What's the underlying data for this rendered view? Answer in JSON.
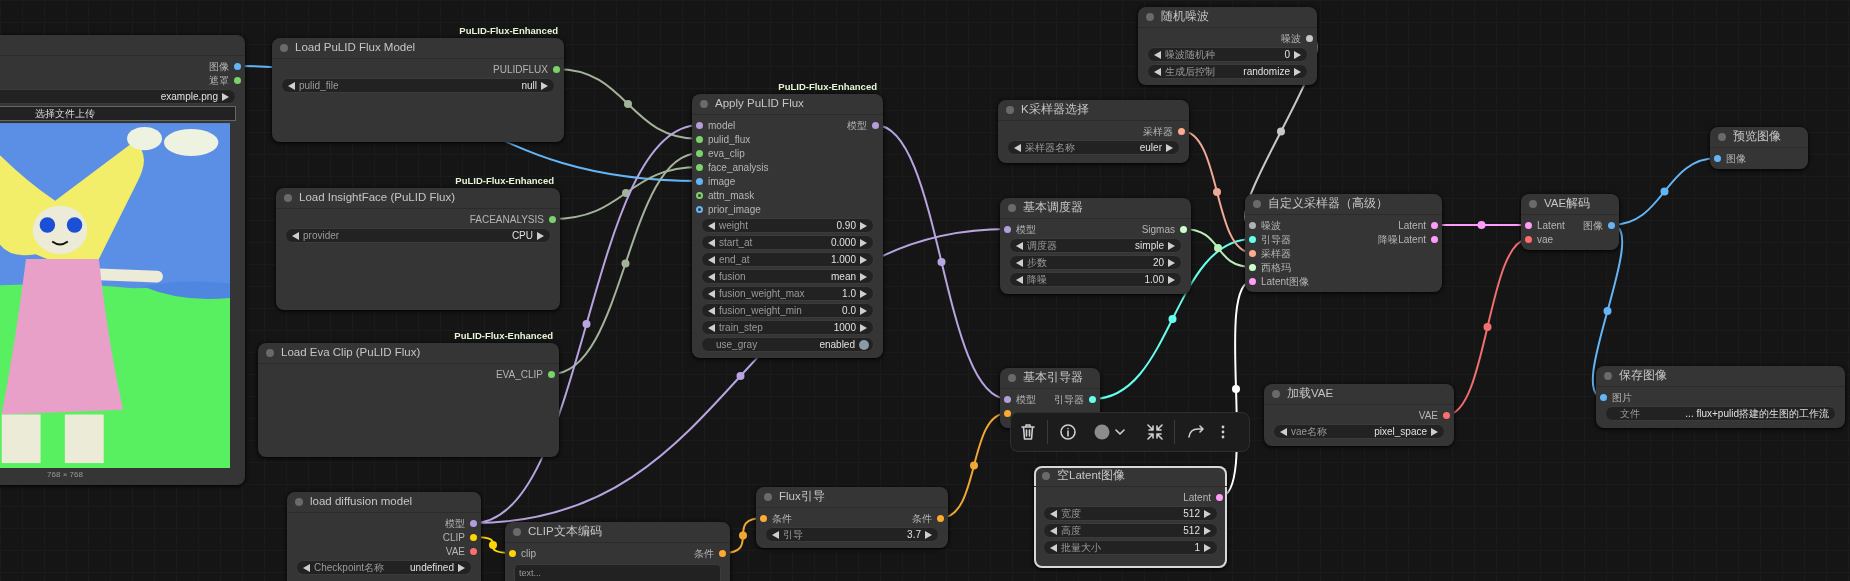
{
  "nodes": [
    {
      "selected": false,
      "outputs": [
        {
          "label": "图像",
          "color": "#64b5f6"
        },
        {
          "label": "遮罩",
          "color": "#7bd36b"
        }
      ],
      "widgets": [
        {
          "kind": "combo",
          "value": "example.png"
        },
        {
          "kind": "button",
          "label": "选择文件上传"
        }
      ],
      "image_preview": {
        "caption": "768 × 768"
      }
    },
    {
      "title": "Load PuLID Flux Model",
      "tag": "PuLID-Flux-Enhanced",
      "selected": false,
      "outputs": [
        {
          "label": "PULIDFLUX",
          "color": "#7bd36b"
        }
      ],
      "widgets": [
        {
          "kind": "combo",
          "label": "pulid_file",
          "value": "null"
        }
      ]
    },
    {
      "title": "Load InsightFace (PuLID Flux)",
      "tag": "PuLID-Flux-Enhanced",
      "selected": false,
      "outputs": [
        {
          "label": "FACEANALYSIS",
          "color": "#7bd36b"
        }
      ],
      "widgets": [
        {
          "kind": "combo",
          "label": "provider",
          "value": "CPU"
        }
      ]
    },
    {
      "title": "Load Eva Clip (PuLID Flux)",
      "tag": "PuLID-Flux-Enhanced",
      "selected": false,
      "outputs": [
        {
          "label": "EVA_CLIP",
          "color": "#7bd36b"
        }
      ]
    },
    {
      "title": "load diffusion model",
      "selected": false,
      "outputs": [
        {
          "label": "模型",
          "color": "#b39ddb"
        },
        {
          "label": "CLIP",
          "color": "#ffd500"
        },
        {
          "label": "VAE",
          "color": "#ff6e6e"
        }
      ],
      "widgets": [
        {
          "kind": "combo",
          "label": "Checkpoint名称",
          "value": "undefined"
        }
      ]
    },
    {
      "title": "CLIP文本编码",
      "selected": false,
      "inputs": [
        {
          "label": "clip",
          "color": "#ffd500",
          "optional": false
        }
      ],
      "outputs": [
        {
          "label": "条件",
          "color": "#ffa931"
        }
      ],
      "widgets": [
        {
          "kind": "text",
          "placeholder": "text..."
        }
      ]
    },
    {
      "title": "Apply PuLID Flux",
      "tag": "PuLID-Flux-Enhanced",
      "selected": false,
      "inputs": [
        {
          "label": "model",
          "color": "#b39ddb",
          "optional": false
        },
        {
          "label": "pulid_flux",
          "color": "#7bd36b",
          "optional": false
        },
        {
          "label": "eva_clip",
          "color": "#7bd36b",
          "optional": false
        },
        {
          "label": "face_analysis",
          "color": "#7bd36b",
          "optional": false
        },
        {
          "label": "image",
          "color": "#64b5f6",
          "optional": false
        },
        {
          "label": "attn_mask",
          "color": "#7bd36b",
          "optional": true
        },
        {
          "label": "prior_image",
          "color": "#64b5f6",
          "optional": true
        }
      ],
      "outputs": [
        {
          "label": "模型",
          "color": "#b39ddb"
        }
      ],
      "widgets": [
        {
          "kind": "number",
          "label": "weight",
          "value": "0.90"
        },
        {
          "kind": "number",
          "label": "start_at",
          "value": "0.000"
        },
        {
          "kind": "number",
          "label": "end_at",
          "value": "1.000"
        },
        {
          "kind": "combo",
          "label": "fusion",
          "value": "mean"
        },
        {
          "kind": "number",
          "label": "fusion_weight_max",
          "value": "1.0"
        },
        {
          "kind": "number",
          "label": "fusion_weight_min",
          "value": "0.0"
        },
        {
          "kind": "number",
          "label": "train_step",
          "value": "1000"
        },
        {
          "kind": "toggle",
          "label": "use_gray",
          "value": "enabled",
          "on": true
        }
      ]
    },
    {
      "title": "随机噪波",
      "selected": false,
      "outputs": [
        {
          "label": "噪波",
          "color": "#c8c8c8"
        }
      ],
      "widgets": [
        {
          "kind": "number",
          "label": "噪波随机种",
          "value": "0"
        },
        {
          "kind": "combo",
          "label": "生成后控制",
          "value": "randomize"
        }
      ]
    },
    {
      "title": "K采样器选择",
      "selected": false,
      "outputs": [
        {
          "label": "采样器",
          "color": "#ffab91"
        }
      ],
      "widgets": [
        {
          "kind": "combo",
          "label": "采样器名称",
          "value": "euler"
        }
      ]
    },
    {
      "title": "基本调度器",
      "selected": false,
      "inputs": [
        {
          "label": "模型",
          "color": "#b39ddb",
          "optional": false
        }
      ],
      "outputs": [
        {
          "label": "Sigmas",
          "color": "#cdffcd"
        }
      ],
      "widgets": [
        {
          "kind": "combo",
          "label": "调度器",
          "value": "simple"
        },
        {
          "kind": "number",
          "label": "步数",
          "value": "20"
        },
        {
          "kind": "number",
          "label": "降噪",
          "value": "1.00"
        }
      ]
    },
    {
      "title": "自定义采样器（高级）",
      "selected": false,
      "inputs": [
        {
          "label": "噪波",
          "color": "#b0b0b0",
          "optional": false
        },
        {
          "label": "引导器",
          "color": "#66ffee",
          "optional": false
        },
        {
          "label": "采样器",
          "color": "#ffab91",
          "optional": false
        },
        {
          "label": "西格玛",
          "color": "#cdffcd",
          "optional": false
        },
        {
          "label": "Latent图像",
          "color": "#ff9cf9",
          "optional": false
        }
      ],
      "outputs": [
        {
          "label": "Latent",
          "color": "#ff9cf9"
        },
        {
          "label": "降噪Latent",
          "color": "#ff9cf9"
        }
      ]
    },
    {
      "title": "VAE解码",
      "selected": false,
      "inputs": [
        {
          "label": "Latent",
          "color": "#ff9cf9",
          "optional": false
        },
        {
          "label": "vae",
          "color": "#ff6e6e",
          "optional": false
        }
      ],
      "outputs": [
        {
          "label": "图像",
          "color": "#64b5f6"
        }
      ]
    },
    {
      "title": "预览图像",
      "selected": false,
      "inputs": [
        {
          "label": "图像",
          "color": "#64b5f6",
          "optional": false
        }
      ]
    },
    {
      "title": "保存图像",
      "selected": false,
      "inputs": [
        {
          "label": "图片",
          "color": "#64b5f6",
          "optional": false
        }
      ],
      "widgets": [
        {
          "kind": "string",
          "label": "文件",
          "value": "... flux+pulid搭建的生图的工作流"
        }
      ]
    },
    {
      "title": "加载VAE",
      "selected": false,
      "outputs": [
        {
          "label": "VAE",
          "color": "#ff6e6e"
        }
      ],
      "widgets": [
        {
          "kind": "combo",
          "label": "vae名称",
          "value": "pixel_space"
        }
      ]
    },
    {
      "title": "基本引导器",
      "selected": false,
      "inputs": [
        {
          "label": "模型",
          "color": "#b39ddb",
          "optional": false
        },
        {
          "color": "#ffa931",
          "optional": false
        }
      ],
      "outputs": [
        {
          "label": "引导器",
          "color": "#66ffee"
        }
      ]
    },
    {
      "title": "Flux引导",
      "selected": false,
      "inputs": [
        {
          "label": "条件",
          "color": "#ffa931",
          "optional": false
        }
      ],
      "outputs": [
        {
          "label": "条件",
          "color": "#ffa931"
        }
      ],
      "widgets": [
        {
          "kind": "number",
          "label": "引导",
          "value": "3.7"
        }
      ]
    },
    {
      "title": "空Latent图像",
      "selected": true,
      "outputs": [
        {
          "label": "Latent",
          "color": "#ff9cf9"
        }
      ],
      "widgets": [
        {
          "kind": "number",
          "label": "宽度",
          "value": "512"
        },
        {
          "kind": "number",
          "label": "高度",
          "value": "512"
        },
        {
          "kind": "number",
          "label": "批量大小",
          "value": "1"
        }
      ]
    }
  ]
}
